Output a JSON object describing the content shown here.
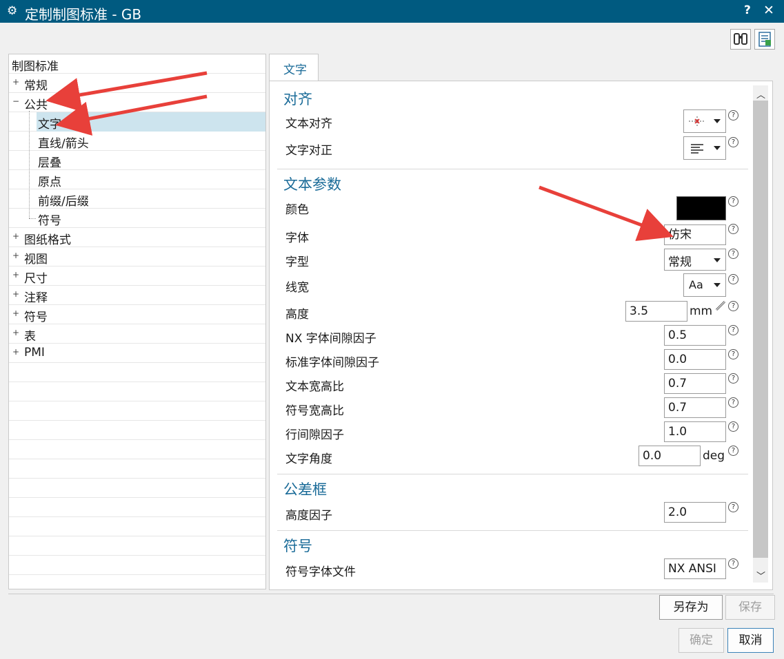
{
  "window": {
    "title": "定制制图标准 - GB",
    "help_label": "?",
    "close_label": "✕",
    "icons": [
      "gear-icon",
      "binoculars-icon",
      "export-list-icon"
    ]
  },
  "tree": {
    "root_label": "制图标准",
    "items": [
      {
        "label": "常规",
        "toggle": "+"
      },
      {
        "label": "公共",
        "toggle": "−"
      },
      {
        "label": "文字",
        "selected": true
      },
      {
        "label": "直线/箭头"
      },
      {
        "label": "层叠"
      },
      {
        "label": "原点"
      },
      {
        "label": "前缀/后缀"
      },
      {
        "label": "符号"
      },
      {
        "label": "图纸格式",
        "toggle": "+"
      },
      {
        "label": "视图",
        "toggle": "+"
      },
      {
        "label": "尺寸",
        "toggle": "+"
      },
      {
        "label": "注释",
        "toggle": "+"
      },
      {
        "label": "符号",
        "toggle": "+"
      },
      {
        "label": "表",
        "toggle": "+"
      },
      {
        "label": "PMI",
        "toggle": "+"
      }
    ]
  },
  "tab": {
    "label": "文字"
  },
  "sections": {
    "align": {
      "title": "对齐",
      "text_align_label": "文本对齐",
      "text_justify_label": "文字对正"
    },
    "text_params": {
      "title": "文本参数",
      "color_label": "颜色",
      "color_value": "#000000",
      "font_label": "字体",
      "font_value": "仿宋",
      "style_label": "字型",
      "style_value": "常规",
      "weight_label": "线宽",
      "weight_value": "Aa",
      "height_label": "高度",
      "height_value": "3.5",
      "height_unit": "mm",
      "nx_gap_label": "NX 字体间隙因子",
      "nx_gap_value": "0.5",
      "std_gap_label": "标准字体间隙因子",
      "std_gap_value": "0.0",
      "aspect_label": "文本宽高比",
      "aspect_value": "0.7",
      "sym_aspect_label": "符号宽高比",
      "sym_aspect_value": "0.7",
      "line_gap_label": "行间隙因子",
      "line_gap_value": "1.0",
      "angle_label": "文字角度",
      "angle_value": "0.0",
      "angle_unit": "deg"
    },
    "tolerance": {
      "title": "公差框",
      "height_factor_label": "高度因子",
      "height_factor_value": "2.0"
    },
    "symbol": {
      "title": "符号",
      "font_file_label": "符号字体文件",
      "font_file_value": "NX ANSI"
    }
  },
  "buttons": {
    "save_as": "另存为",
    "save": "保存",
    "ok": "确定",
    "cancel": "取消"
  },
  "annotation_color": "#e8403a",
  "help_glyph": "?"
}
